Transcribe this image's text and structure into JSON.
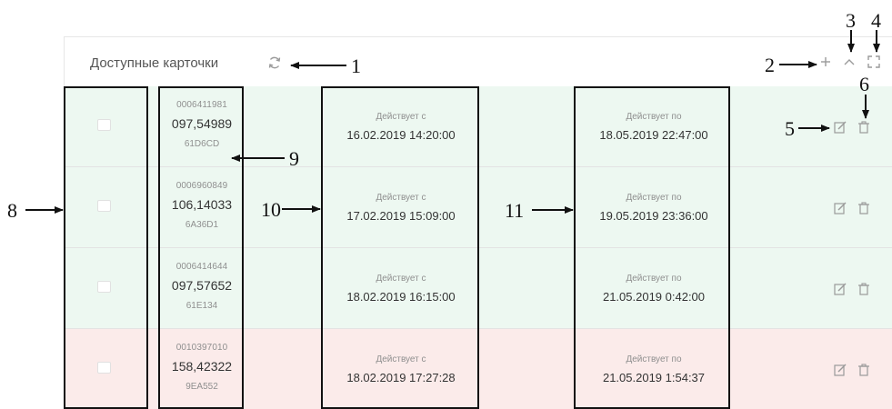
{
  "panel": {
    "title": "Доступные карточки",
    "tools": [
      "add-icon",
      "collapse-icon",
      "fullscreen-icon"
    ]
  },
  "colors": {
    "row_active": "#edf8f1",
    "row_expired": "#fbebea",
    "text_main": "#333333",
    "text_muted": "#8f8f8f",
    "outline": "#111111"
  },
  "rows": [
    {
      "status": "active",
      "card_number": "0006411981",
      "card_code": "097,54989",
      "card_hex": "61D6CD",
      "valid_from_label": "Действует с",
      "valid_from": "16.02.2019 14:20:00",
      "valid_to_label": "Действует по",
      "valid_to": "18.05.2019 22:47:00"
    },
    {
      "status": "active",
      "card_number": "0006960849",
      "card_code": "106,14033",
      "card_hex": "6A36D1",
      "valid_from_label": "Действует с",
      "valid_from": "17.02.2019 15:09:00",
      "valid_to_label": "Действует по",
      "valid_to": "19.05.2019 23:36:00"
    },
    {
      "status": "active",
      "card_number": "0006414644",
      "card_code": "097,57652",
      "card_hex": "61E134",
      "valid_from_label": "Действует с",
      "valid_from": "18.02.2019 16:15:00",
      "valid_to_label": "Действует по",
      "valid_to": "21.05.2019 0:42:00"
    },
    {
      "status": "expired",
      "card_number": "0010397010",
      "card_code": "158,42322",
      "card_hex": "9EA552",
      "valid_from_label": "Действует с",
      "valid_from": "18.02.2019 17:27:28",
      "valid_to_label": "Действует по",
      "valid_to": "21.05.2019 1:54:37"
    }
  ],
  "callouts": {
    "c1": "1",
    "c2": "2",
    "c3": "3",
    "c4": "4",
    "c5": "5",
    "c6": "6",
    "c8": "8",
    "c9": "9",
    "c10": "10",
    "c11": "11"
  }
}
